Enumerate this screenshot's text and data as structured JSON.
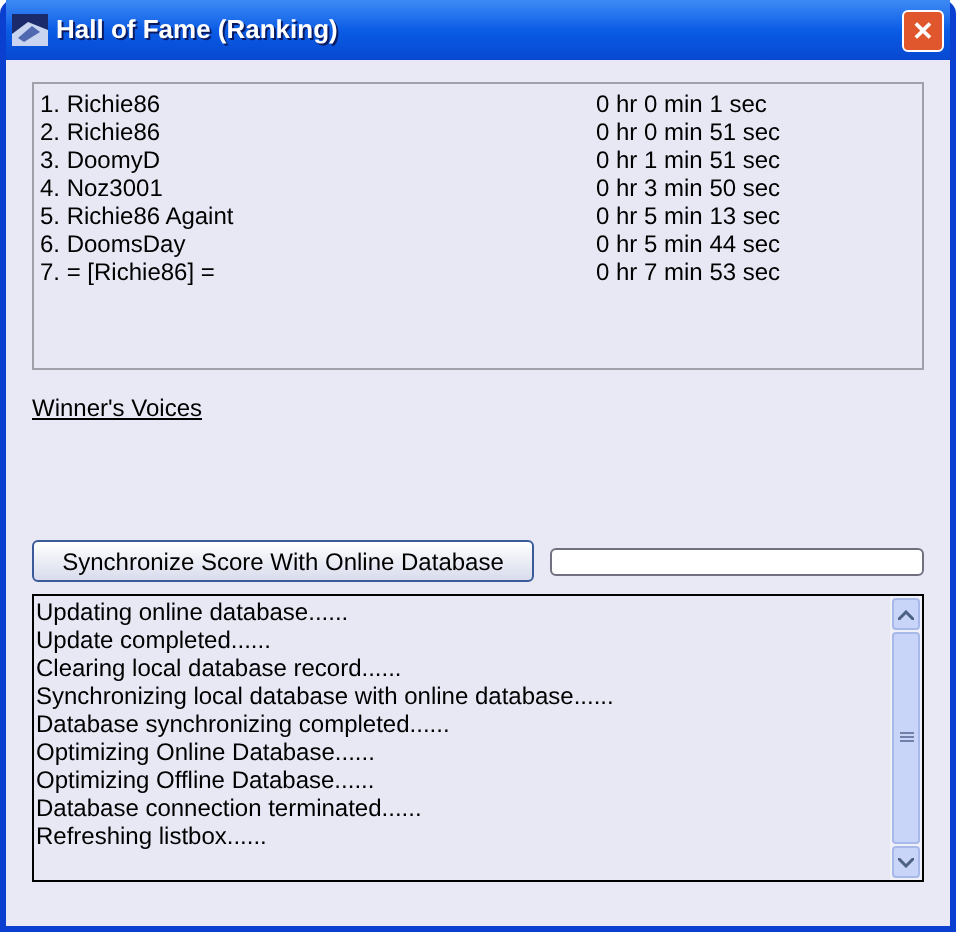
{
  "window": {
    "title": "Hall of Fame (Ranking)",
    "close": "✕"
  },
  "ranking": [
    {
      "name": "1. Richie86",
      "time": "0 hr 0 min 1 sec"
    },
    {
      "name": "2. Richie86",
      "time": "0 hr 0 min 51 sec"
    },
    {
      "name": "3. DoomyD",
      "time": "0 hr 1 min 51 sec"
    },
    {
      "name": "4. Noz3001",
      "time": "0 hr 3 min 50 sec"
    },
    {
      "name": "5. Richie86 Againt",
      "time": "0 hr 5 min 13 sec"
    },
    {
      "name": "6. DoomsDay",
      "time": "0 hr 5 min 44 sec"
    },
    {
      "name": "7. = [Richie86] =",
      "time": "0 hr 7 min 53 sec"
    }
  ],
  "winners_link": "Winner's Voices",
  "sync_button": "Synchronize Score With Online Database",
  "progress": {
    "level": 0
  },
  "log": [
    "Updating online database......",
    "Update completed......",
    "Clearing local database record......",
    "Synchronizing local database with online database......",
    "Database synchronizing completed......",
    "Optimizing Online Database......",
    "Optimizing Offline Database......",
    "Database connection terminated......",
    "Refreshing listbox......"
  ]
}
